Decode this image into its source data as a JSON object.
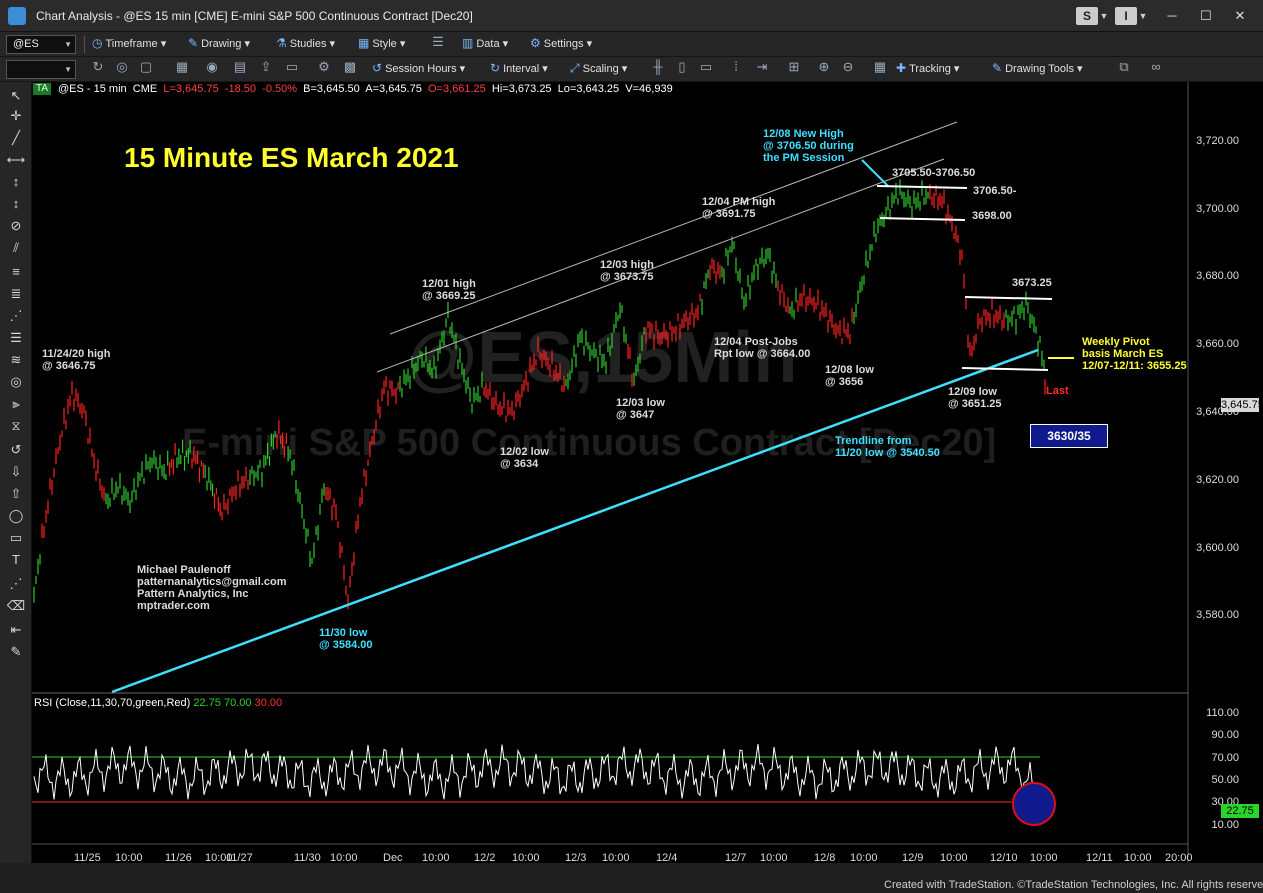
{
  "window": {
    "title": "Chart Analysis - @ES 15 min [CME] E-mini S&P 500 Continuous Contract [Dec20]",
    "badge_s": "S",
    "badge_i": "I",
    "min": "─",
    "max": "☐",
    "close": "✕"
  },
  "toolbar1": {
    "symbol": "@ES",
    "timeframe": "Timeframe",
    "drawing": "Drawing",
    "studies": "Studies",
    "style": "Style",
    "data": "Data",
    "settings": "Settings"
  },
  "toolbar2": {
    "interval_box": "",
    "session_hours": "Session Hours",
    "interval": "Interval",
    "scaling": "Scaling",
    "tracking": "Tracking",
    "drawing_tools": "Drawing Tools"
  },
  "chart": {
    "header": {
      "badge": "TA",
      "symbol": "@ES - 15 min",
      "exchange": "CME",
      "last": "L=3,645.75",
      "chg": "-18.50",
      "pct": "-0.50%",
      "bid": "B=3,645.50",
      "ask": "A=3,645.75",
      "open": "O=3,661.25",
      "hi": "Hi=3,673.25",
      "lo": "Lo=3,643.25",
      "vol": "V=46,939"
    },
    "title": "15 Minute ES March 2021",
    "watermark_symbol": "@ES,15Min",
    "watermark_name": "E-mini S&P 500 Continuous Contract [Dec20]",
    "price_labels": [
      "3,720.00",
      "3,700.00",
      "3,680.00",
      "3,660.00",
      "3,640.00",
      "3,620.00",
      "3,600.00",
      "3,580.00"
    ],
    "last_price": "3,645.75",
    "rsi_labels": [
      "110.00",
      "90.00",
      "70.00",
      "50.00",
      "30.00",
      "10.00"
    ],
    "rsi_last": "22.75",
    "time_labels": [
      "11/25",
      "10:00",
      "11/26",
      "10:00",
      "11/27",
      "11/30",
      "10:00",
      "Dec",
      "10:00",
      "12/2",
      "10:00",
      "12/3",
      "10:00",
      "12/4",
      "12/7",
      "10:00",
      "12/8",
      "10:00",
      "12/9",
      "10:00",
      "12/10",
      "10:00",
      "12/11",
      "10:00",
      "20:00"
    ],
    "rsi_header": {
      "name": "RSI (Close,11,30,70,green,Red)",
      "v1": "22.75",
      "v2": "70.00",
      "v3": "30.00"
    },
    "box_target": "3630/35",
    "annotations": {
      "a1124": "11/24/20 high\n@ 3646.75",
      "a1201": "12/01 high\n@ 3669.25",
      "a1203h": "12/03 high\n@ 3673.75",
      "a1204h": "12/04 PM high\n@ 3691.75",
      "a1208nh": "12/08 New High\n@ 3706.50 during\nthe PM Session",
      "a3705": "3705.50-3706.50",
      "a3706": "3706.50-",
      "a3698": "3698.00",
      "a3673": "3673.25",
      "a1204pj": "12/04 Post-Jobs\nRpt low @ 3664.00",
      "a1208l": "12/08 low\n@ 3656",
      "a1209l": "12/09 low\n@ 3651.25",
      "a1203l": "12/03 low\n@ 3647",
      "a1202l": "12/02 low\n@ 3634",
      "trend": "Trendline from\n11/20 low @ 3540.50",
      "a1130": "11/30 low\n@ 3584.00",
      "pivot": "Weekly Pivot\nbasis March ES\n12/07-12/11: 3655.25",
      "last": "Last",
      "author": "Michael Paulenoff\npatternanalytics@gmail.com\nPattern Analytics, Inc\nmptrader.com"
    }
  },
  "footer": {
    "credit": "Created with TradeStation. ©TradeStation Technologies, Inc. All rights reserved."
  },
  "colors": {
    "bull": "#2ecc2e",
    "bear": "#ff2222",
    "trend": "#3fe0ff",
    "channel": "#bbbbbb",
    "title": "#ffff2b"
  }
}
